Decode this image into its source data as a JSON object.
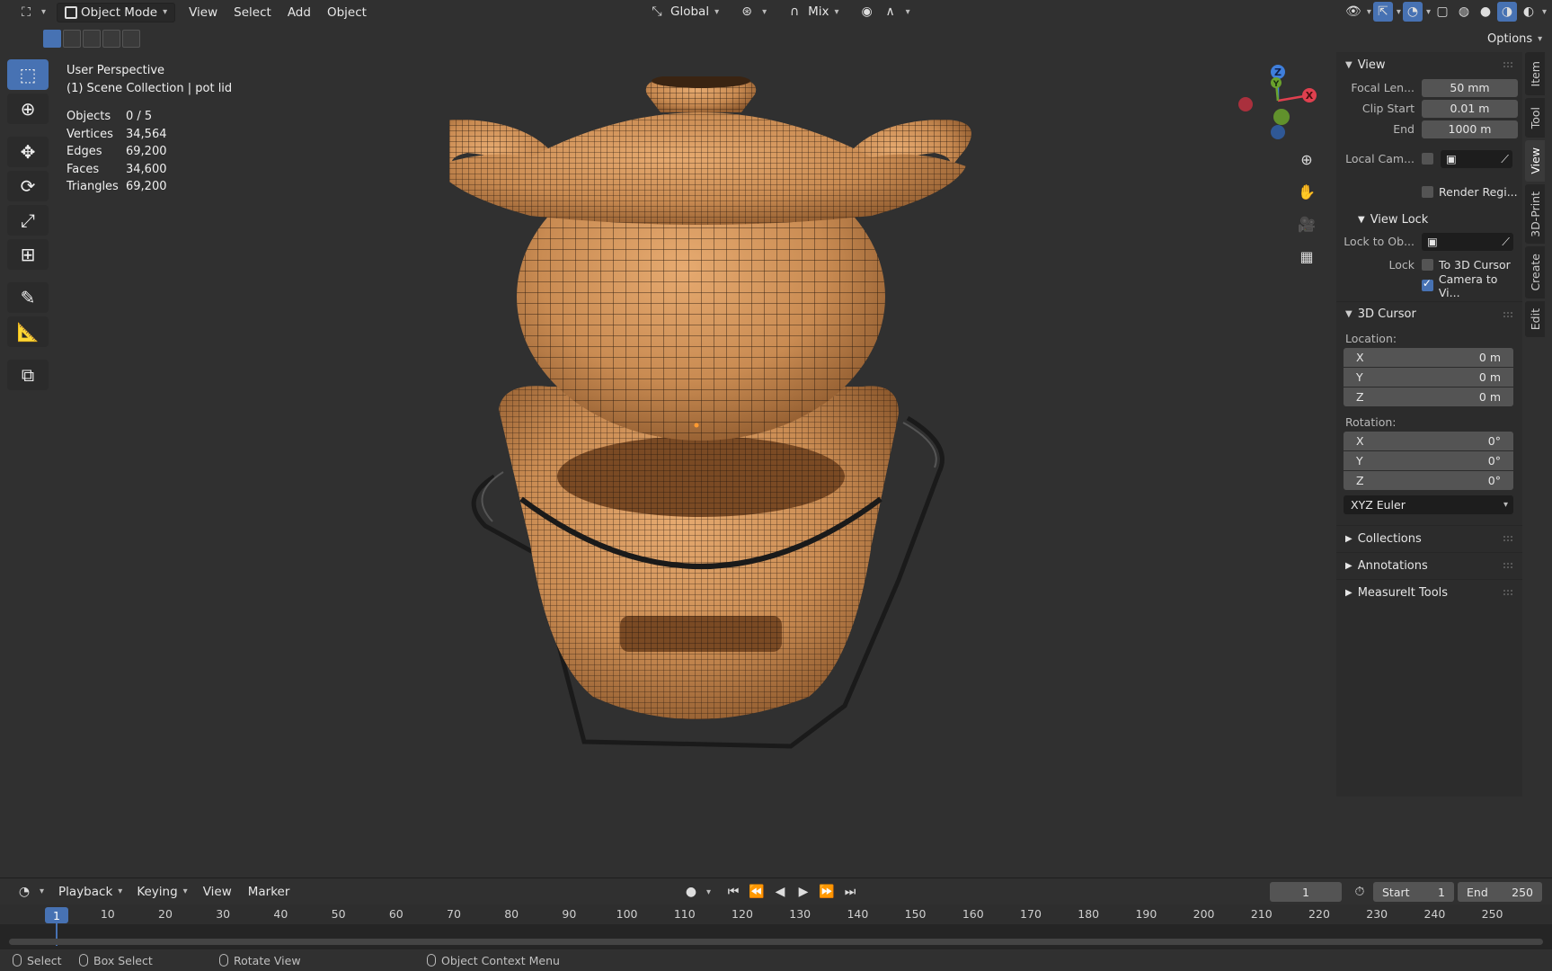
{
  "header": {
    "mode": "Object Mode",
    "menu": [
      "View",
      "Select",
      "Add",
      "Object"
    ],
    "orientation": "Global",
    "pivot": "Mix",
    "options_label": "Options"
  },
  "overlay": {
    "perspective": "User Perspective",
    "collection": "(1) Scene Collection | pot lid",
    "stats": [
      {
        "key": "Objects",
        "value": "0 / 5"
      },
      {
        "key": "Vertices",
        "value": "34,564"
      },
      {
        "key": "Edges",
        "value": "69,200"
      },
      {
        "key": "Faces",
        "value": "34,600"
      },
      {
        "key": "Triangles",
        "value": "69,200"
      }
    ]
  },
  "gizmo": {
    "x": "X",
    "y": "Y",
    "z": "Z"
  },
  "sidebar": {
    "view_panel": {
      "title": "View",
      "focal_label": "Focal Len...",
      "focal_value": "50 mm",
      "clip_start_label": "Clip Start",
      "clip_start_value": "0.01 m",
      "clip_end_label": "End",
      "clip_end_value": "1000 m",
      "local_cam_label": "Local Cam...",
      "render_region_label": "Render Regi..."
    },
    "view_lock": {
      "title": "View Lock",
      "lock_obj_label": "Lock to Ob...",
      "lock_label": "Lock",
      "to_cursor_label": "To 3D Cursor",
      "camera_label": "Camera to Vi..."
    },
    "cursor_panel": {
      "title": "3D Cursor",
      "location_label": "Location:",
      "location": [
        {
          "axis": "X",
          "value": "0 m"
        },
        {
          "axis": "Y",
          "value": "0 m"
        },
        {
          "axis": "Z",
          "value": "0 m"
        }
      ],
      "rotation_label": "Rotation:",
      "rotation": [
        {
          "axis": "X",
          "value": "0°"
        },
        {
          "axis": "Y",
          "value": "0°"
        },
        {
          "axis": "Z",
          "value": "0°"
        }
      ],
      "rotation_mode": "XYZ Euler"
    },
    "closed_panels": [
      "Collections",
      "Annotations",
      "MeasureIt Tools"
    ],
    "tabs": [
      "Item",
      "Tool",
      "View",
      "3D-Print",
      "Create",
      "Edit"
    ]
  },
  "timeline": {
    "playback": "Playback",
    "keying": "Keying",
    "view": "View",
    "marker": "Marker",
    "current_frame": "1",
    "start_label": "Start",
    "start_value": "1",
    "end_label": "End",
    "end_value": "250",
    "ticks": [
      "10",
      "20",
      "30",
      "40",
      "50",
      "60",
      "70",
      "80",
      "90",
      "100",
      "110",
      "120",
      "130",
      "140",
      "150",
      "160",
      "170",
      "180",
      "190",
      "200",
      "210",
      "220",
      "230",
      "240",
      "250"
    ]
  },
  "statusbar": {
    "select": "Select",
    "box_select": "Box Select",
    "rotate_view": "Rotate View",
    "context_menu": "Object Context Menu"
  },
  "colors": {
    "accent": "#4772b3",
    "clay": "#c98b52",
    "axis_x": "#e0404f",
    "axis_y": "#6aa22c",
    "axis_z": "#3f7fdc"
  }
}
